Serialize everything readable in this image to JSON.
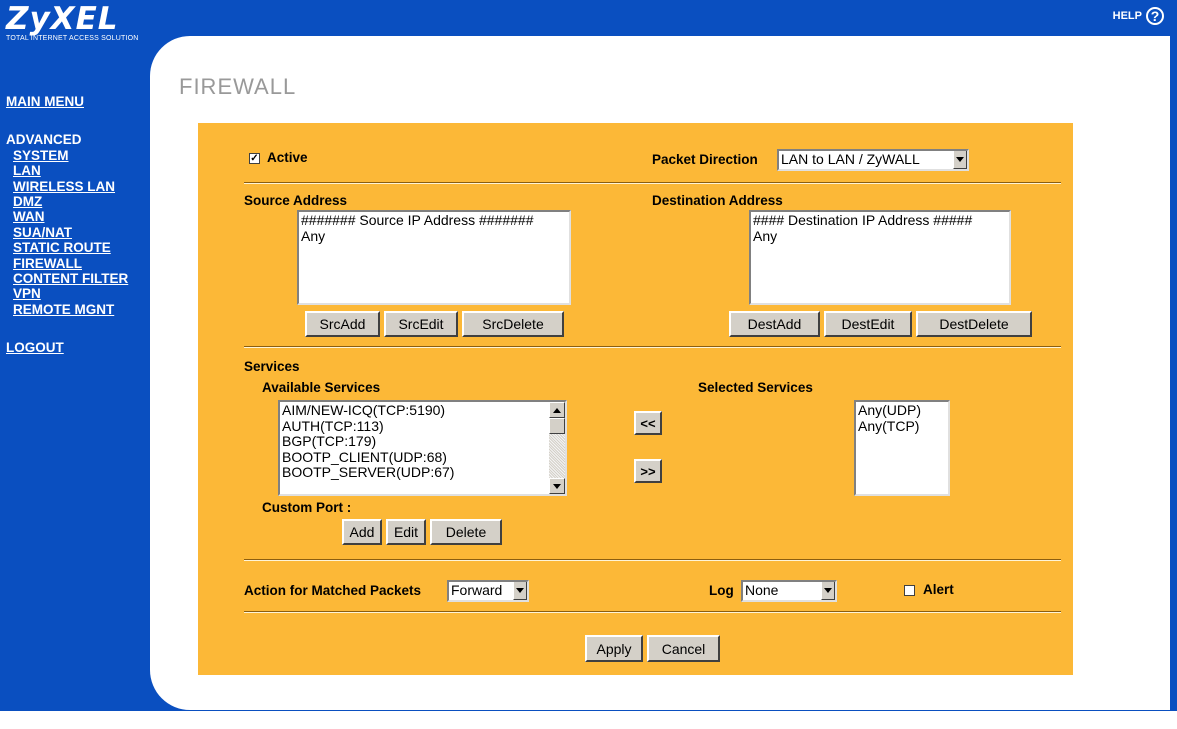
{
  "header": {
    "logo_brand": "ZyXEL",
    "logo_tagline": "TOTAL INTERNET ACCESS SOLUTION",
    "help_label": "HELP",
    "help_icon_glyph": "?"
  },
  "nav": {
    "main_menu": "MAIN MENU",
    "advanced": "ADVANCED",
    "items": [
      "SYSTEM",
      "LAN",
      "WIRELESS LAN",
      "DMZ",
      "WAN",
      "SUA/NAT",
      "STATIC ROUTE",
      "FIREWALL",
      "CONTENT FILTER",
      "VPN",
      "REMOTE MGNT"
    ],
    "logout": "LOGOUT"
  },
  "page": {
    "title": "FIREWALL"
  },
  "firewall": {
    "active_label": "Active",
    "active_checked": true,
    "packet_direction_label": "Packet Direction",
    "packet_direction_value": "LAN to LAN / ZyWALL",
    "source_address_label": "Source Address",
    "source_list": [
      "####### Source IP Address #######",
      "Any"
    ],
    "src_add": "SrcAdd",
    "src_edit": "SrcEdit",
    "src_delete": "SrcDelete",
    "destination_address_label": "Destination Address",
    "dest_list": [
      "#### Destination IP Address #####",
      "Any"
    ],
    "dest_add": "DestAdd",
    "dest_edit": "DestEdit",
    "dest_delete": "DestDelete",
    "services_label": "Services",
    "available_services_label": "Available Services",
    "available_services": [
      "AIM/NEW-ICQ(TCP:5190)",
      "AUTH(TCP:113)",
      "BGP(TCP:179)",
      "BOOTP_CLIENT(UDP:68)",
      "BOOTP_SERVER(UDP:67)"
    ],
    "move_left": "<<",
    "move_right": ">>",
    "selected_services_label": "Selected Services",
    "selected_services": [
      "Any(UDP)",
      "Any(TCP)"
    ],
    "custom_port_label": "Custom Port :",
    "add": "Add",
    "edit": "Edit",
    "delete": "Delete",
    "action_label": "Action for Matched Packets",
    "action_value": "Forward",
    "log_label": "Log",
    "log_value": "None",
    "alert_label": "Alert",
    "alert_checked": false,
    "apply": "Apply",
    "cancel": "Cancel"
  }
}
